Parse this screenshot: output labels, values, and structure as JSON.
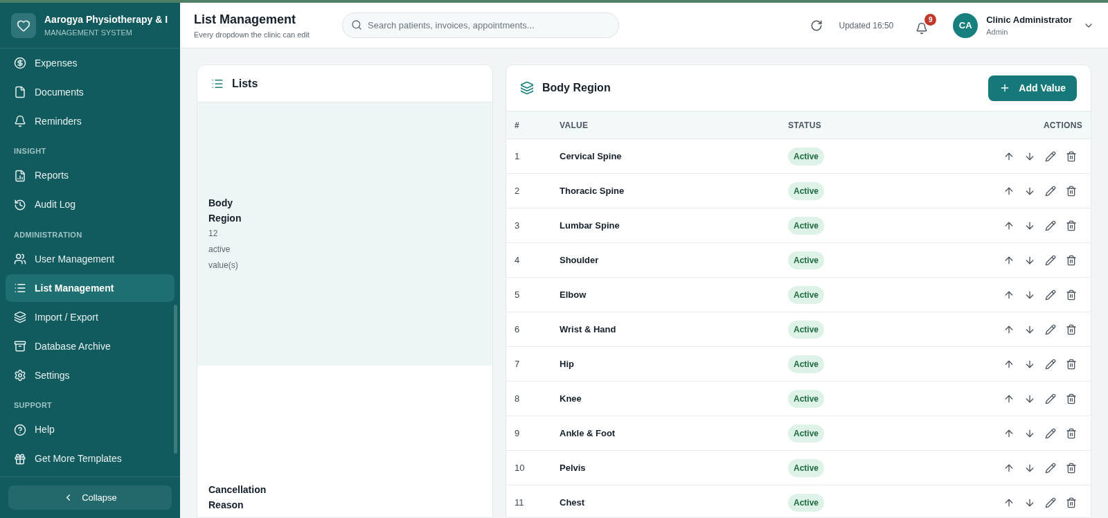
{
  "brand": {
    "name": "Aarogya Physiotherapy & I",
    "subtitle": "MANAGEMENT SYSTEM"
  },
  "sidebar": {
    "sections": [
      {
        "items": [
          {
            "label": "Expenses",
            "selected": false
          },
          {
            "label": "Documents",
            "selected": false
          },
          {
            "label": "Reminders",
            "selected": false
          }
        ]
      },
      {
        "title": "INSIGHT",
        "items": [
          {
            "label": "Reports",
            "selected": false
          },
          {
            "label": "Audit Log",
            "selected": false
          }
        ]
      },
      {
        "title": "ADMINISTRATION",
        "items": [
          {
            "label": "User Management",
            "selected": false
          },
          {
            "label": "List Management",
            "selected": true
          },
          {
            "label": "Import / Export",
            "selected": false
          },
          {
            "label": "Database Archive",
            "selected": false
          },
          {
            "label": "Settings",
            "selected": false
          }
        ]
      },
      {
        "title": "SUPPORT",
        "items": [
          {
            "label": "Help",
            "selected": false
          },
          {
            "label": "Get More Templates",
            "selected": false
          }
        ]
      }
    ],
    "collapse": "Collapse"
  },
  "header": {
    "title": "List Management",
    "subtitle": "Every dropdown the clinic can edit",
    "search": {
      "placeholder": "Search patients, invoices, appointments..."
    },
    "updated": "Updated 16:50",
    "notifications": "9",
    "user": {
      "initials": "CA",
      "name": "Clinic Administrator",
      "role": "Admin"
    }
  },
  "lists": {
    "title": "Lists",
    "items": [
      {
        "name": "Body Region",
        "count": "12",
        "status": "active",
        "unit": "value(s)",
        "selected": true
      },
      {
        "name": "Cancellation Reason",
        "selected": false
      }
    ]
  },
  "table": {
    "title": "Body Region",
    "add_button": "Add Value",
    "columns": [
      "#",
      "VALUE",
      "STATUS",
      "ACTIONS"
    ],
    "rows": [
      {
        "index": "1",
        "value": "Cervical Spine",
        "status": "Active"
      },
      {
        "index": "2",
        "value": "Thoracic Spine",
        "status": "Active"
      },
      {
        "index": "3",
        "value": "Lumbar Spine",
        "status": "Active"
      },
      {
        "index": "4",
        "value": "Shoulder",
        "status": "Active"
      },
      {
        "index": "5",
        "value": "Elbow",
        "status": "Active"
      },
      {
        "index": "6",
        "value": "Wrist & Hand",
        "status": "Active"
      },
      {
        "index": "7",
        "value": "Hip",
        "status": "Active"
      },
      {
        "index": "8",
        "value": "Knee",
        "status": "Active"
      },
      {
        "index": "9",
        "value": "Ankle & Foot",
        "status": "Active"
      },
      {
        "index": "10",
        "value": "Pelvis",
        "status": "Active"
      },
      {
        "index": "11",
        "value": "Chest",
        "status": "Active"
      }
    ]
  }
}
